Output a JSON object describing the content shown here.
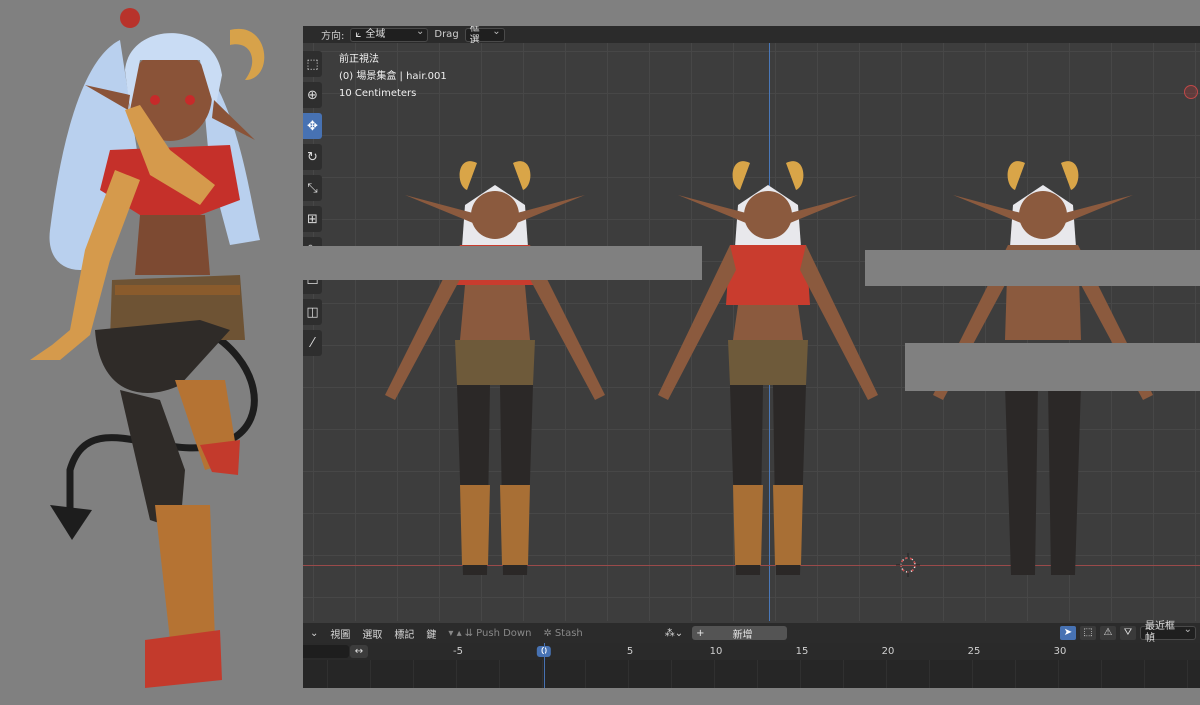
{
  "header": {
    "orientation_label": "方向:",
    "orientation_value": "全域",
    "drag_label": "Drag",
    "drag_value": "框選"
  },
  "viewport": {
    "view_name": "前正視法",
    "collection_object": "(0) 場景集盒 | hair.001",
    "scale": "10 Centimeters"
  },
  "toolbar": {
    "tools": [
      "select-box",
      "cursor",
      "move",
      "rotate",
      "scale",
      "transform",
      "annotate",
      "measure",
      "add-cube",
      "draw"
    ],
    "active_tool": "move"
  },
  "timeline": {
    "menu": [
      "視圖",
      "選取",
      "標記",
      "鍵"
    ],
    "push_down": "Push Down",
    "stash": "Stash",
    "new_label": "新增",
    "keying": "最近框幀",
    "ticks": [
      "-5",
      "0",
      "5",
      "10",
      "15",
      "20",
      "25",
      "30"
    ],
    "current_frame": "0"
  },
  "colors": {
    "accent": "#4772b3",
    "axis_y": "#4a78b8",
    "axis_x": "#9a4a4a",
    "viewport_bg": "#3d3d3d"
  }
}
